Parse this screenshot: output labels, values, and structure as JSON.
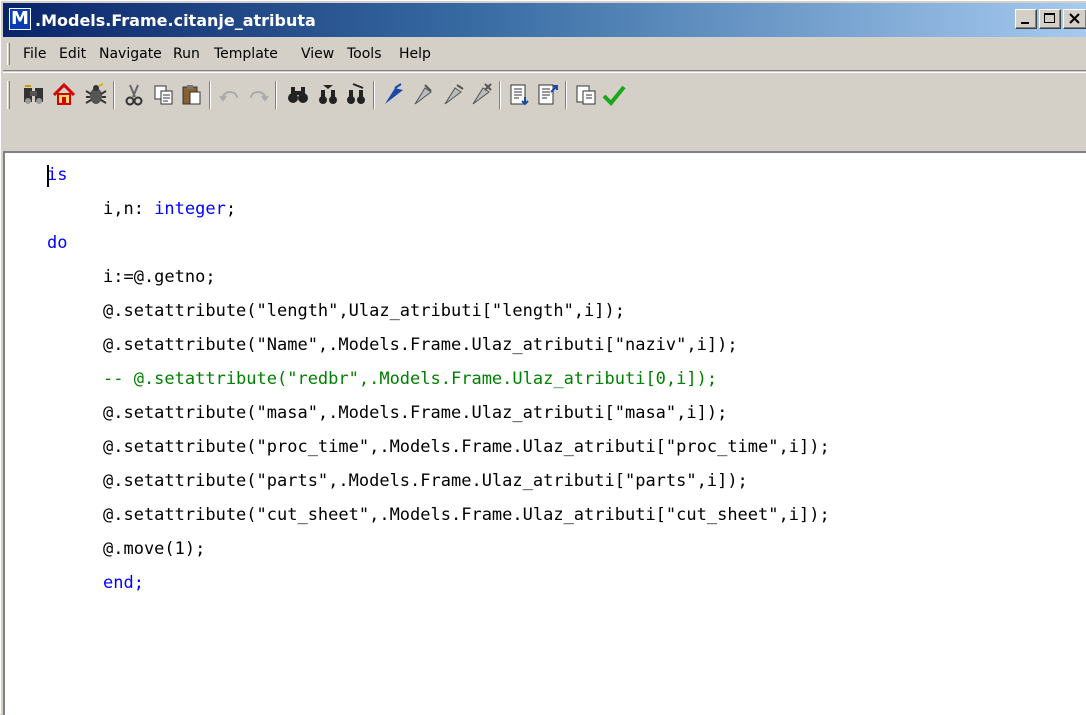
{
  "window": {
    "title": ".Models.Frame.citanje_atributa",
    "app_icon_letter": "M"
  },
  "menu": [
    "File",
    "Edit",
    "Navigate",
    "Run",
    "Template",
    "View",
    "Tools",
    "Help"
  ],
  "toolbar_icons": [
    "debug-binoculars-icon",
    "home-icon",
    "bug-icon",
    "cut-icon",
    "copy-icon",
    "paste-icon",
    "undo-icon",
    "redo-icon",
    "find-icon",
    "find-next-icon",
    "replace-icon",
    "bookmark-icon",
    "toggle-breakpoint-icon",
    "next-breakpoint-icon",
    "clear-breakpoints-icon",
    "indent-icon",
    "outdent-icon",
    "compile-icon",
    "apply-check-icon"
  ],
  "code": {
    "l1": "is",
    "l2_a": "i,n: ",
    "l2_b": "integer",
    "l2_c": ";",
    "l3": "do",
    "l4": "i:=@.getno;",
    "l5": "@.setattribute(\"length\",Ulaz_atributi[\"length\",i]);",
    "l6": "@.setattribute(\"Name\",.Models.Frame.Ulaz_atributi[\"naziv\",i]);",
    "l7": "-- @.setattribute(\"redbr\",.Models.Frame.Ulaz_atributi[0,i]);",
    "l8": "@.setattribute(\"masa\",.Models.Frame.Ulaz_atributi[\"masa\",i]);",
    "l9": "@.setattribute(\"proc_time\",.Models.Frame.Ulaz_atributi[\"proc_time\",i]);",
    "l10": "@.setattribute(\"parts\",.Models.Frame.Ulaz_atributi[\"parts\",i]);",
    "l11": "@.setattribute(\"cut_sheet\",.Models.Frame.Ulaz_atributi[\"cut_sheet\",i]);",
    "l12": "@.move(1);",
    "l13": "end;"
  }
}
